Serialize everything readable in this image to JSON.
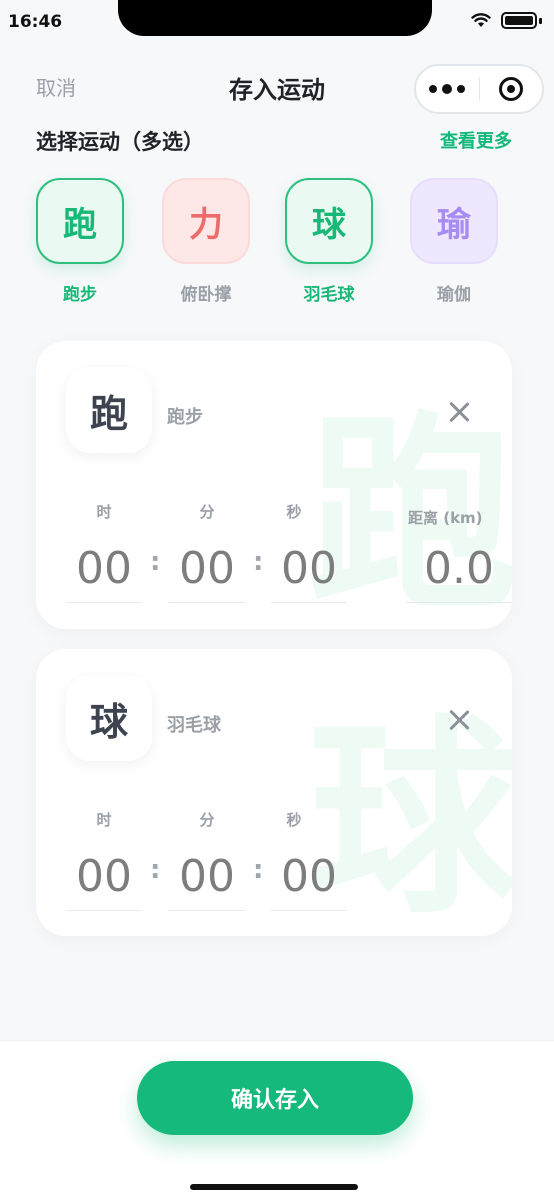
{
  "status_bar": {
    "time": "16:46"
  },
  "nav": {
    "cancel": "取消",
    "title": "存入运动"
  },
  "section": {
    "title": "选择运动（多选）",
    "more": "查看更多"
  },
  "sports": [
    {
      "glyph": "跑",
      "label": "跑步",
      "selected": true
    },
    {
      "glyph": "力",
      "label": "俯卧撑",
      "selected": false
    },
    {
      "glyph": "球",
      "label": "羽毛球",
      "selected": true
    },
    {
      "glyph": "瑜",
      "label": "瑜伽",
      "selected": false
    }
  ],
  "cards": [
    {
      "glyph": "跑",
      "name": "跑步",
      "watermark": "跑",
      "labels": {
        "hour": "时",
        "minute": "分",
        "second": "秒",
        "distance": "距离 (km)"
      },
      "values": {
        "hour": "00",
        "minute": "00",
        "second": "00",
        "distance": "0.0"
      },
      "colon": ":"
    },
    {
      "glyph": "球",
      "name": "羽毛球",
      "watermark": "球",
      "labels": {
        "hour": "时",
        "minute": "分",
        "second": "秒"
      },
      "values": {
        "hour": "00",
        "minute": "00",
        "second": "00"
      },
      "colon": ":"
    }
  ],
  "confirm_label": "确认存入",
  "colors": {
    "accent": "#14b97b",
    "muted": "#9aa0a6"
  }
}
